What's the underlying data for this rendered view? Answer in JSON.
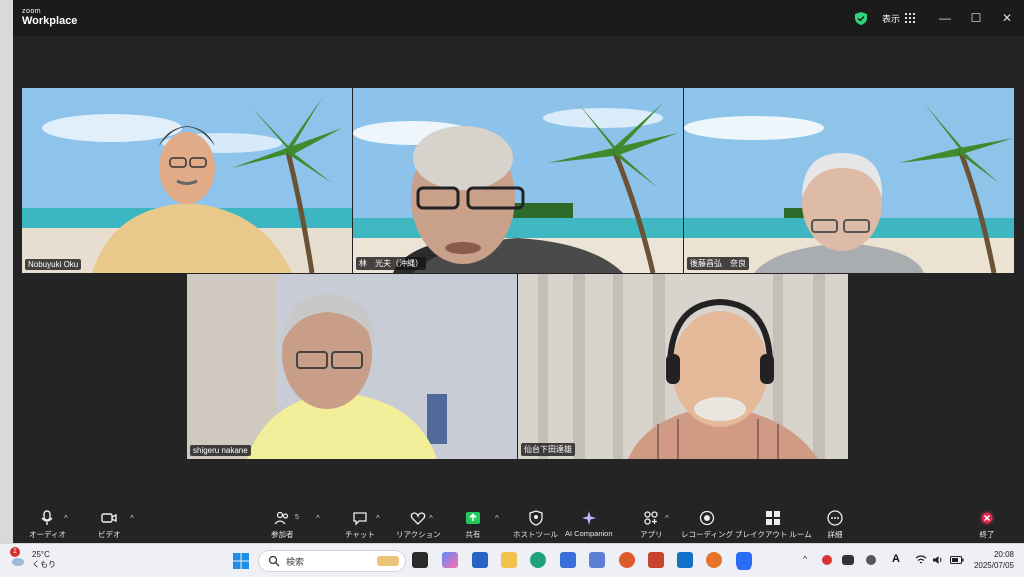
{
  "window": {
    "brand_small": "zoom",
    "brand_big": "Workplace",
    "view_label": "表示"
  },
  "participants": {
    "p1": "Nobuyuki Oku",
    "p2": "林　光夫（沖縄）",
    "p3": "後藤昌弘　奈良",
    "p4": "shigeru nakane",
    "p5": "仙台下田達雄"
  },
  "toolbar": {
    "audio": "オーディオ",
    "video": "ビデオ",
    "participants": "参加者",
    "participants_count": "5",
    "chat": "チャット",
    "reactions": "リアクション",
    "share": "共有",
    "host_tools": "ホストツール",
    "ai_companion": "AI Companion",
    "apps": "アプリ",
    "recording": "レコーディング",
    "breakout": "ブレイクアウト ルーム",
    "more": "詳細",
    "end": "終了"
  },
  "taskbar": {
    "temp": "25°C",
    "weather": "くもり",
    "weather_badge": "1",
    "search_placeholder": "検索",
    "time": "20:08",
    "date": "2025/07/05",
    "ime": "A"
  },
  "colors": {
    "active_border": "#2fd67a",
    "end_red": "#e0284c",
    "share_green": "#23c85a"
  }
}
